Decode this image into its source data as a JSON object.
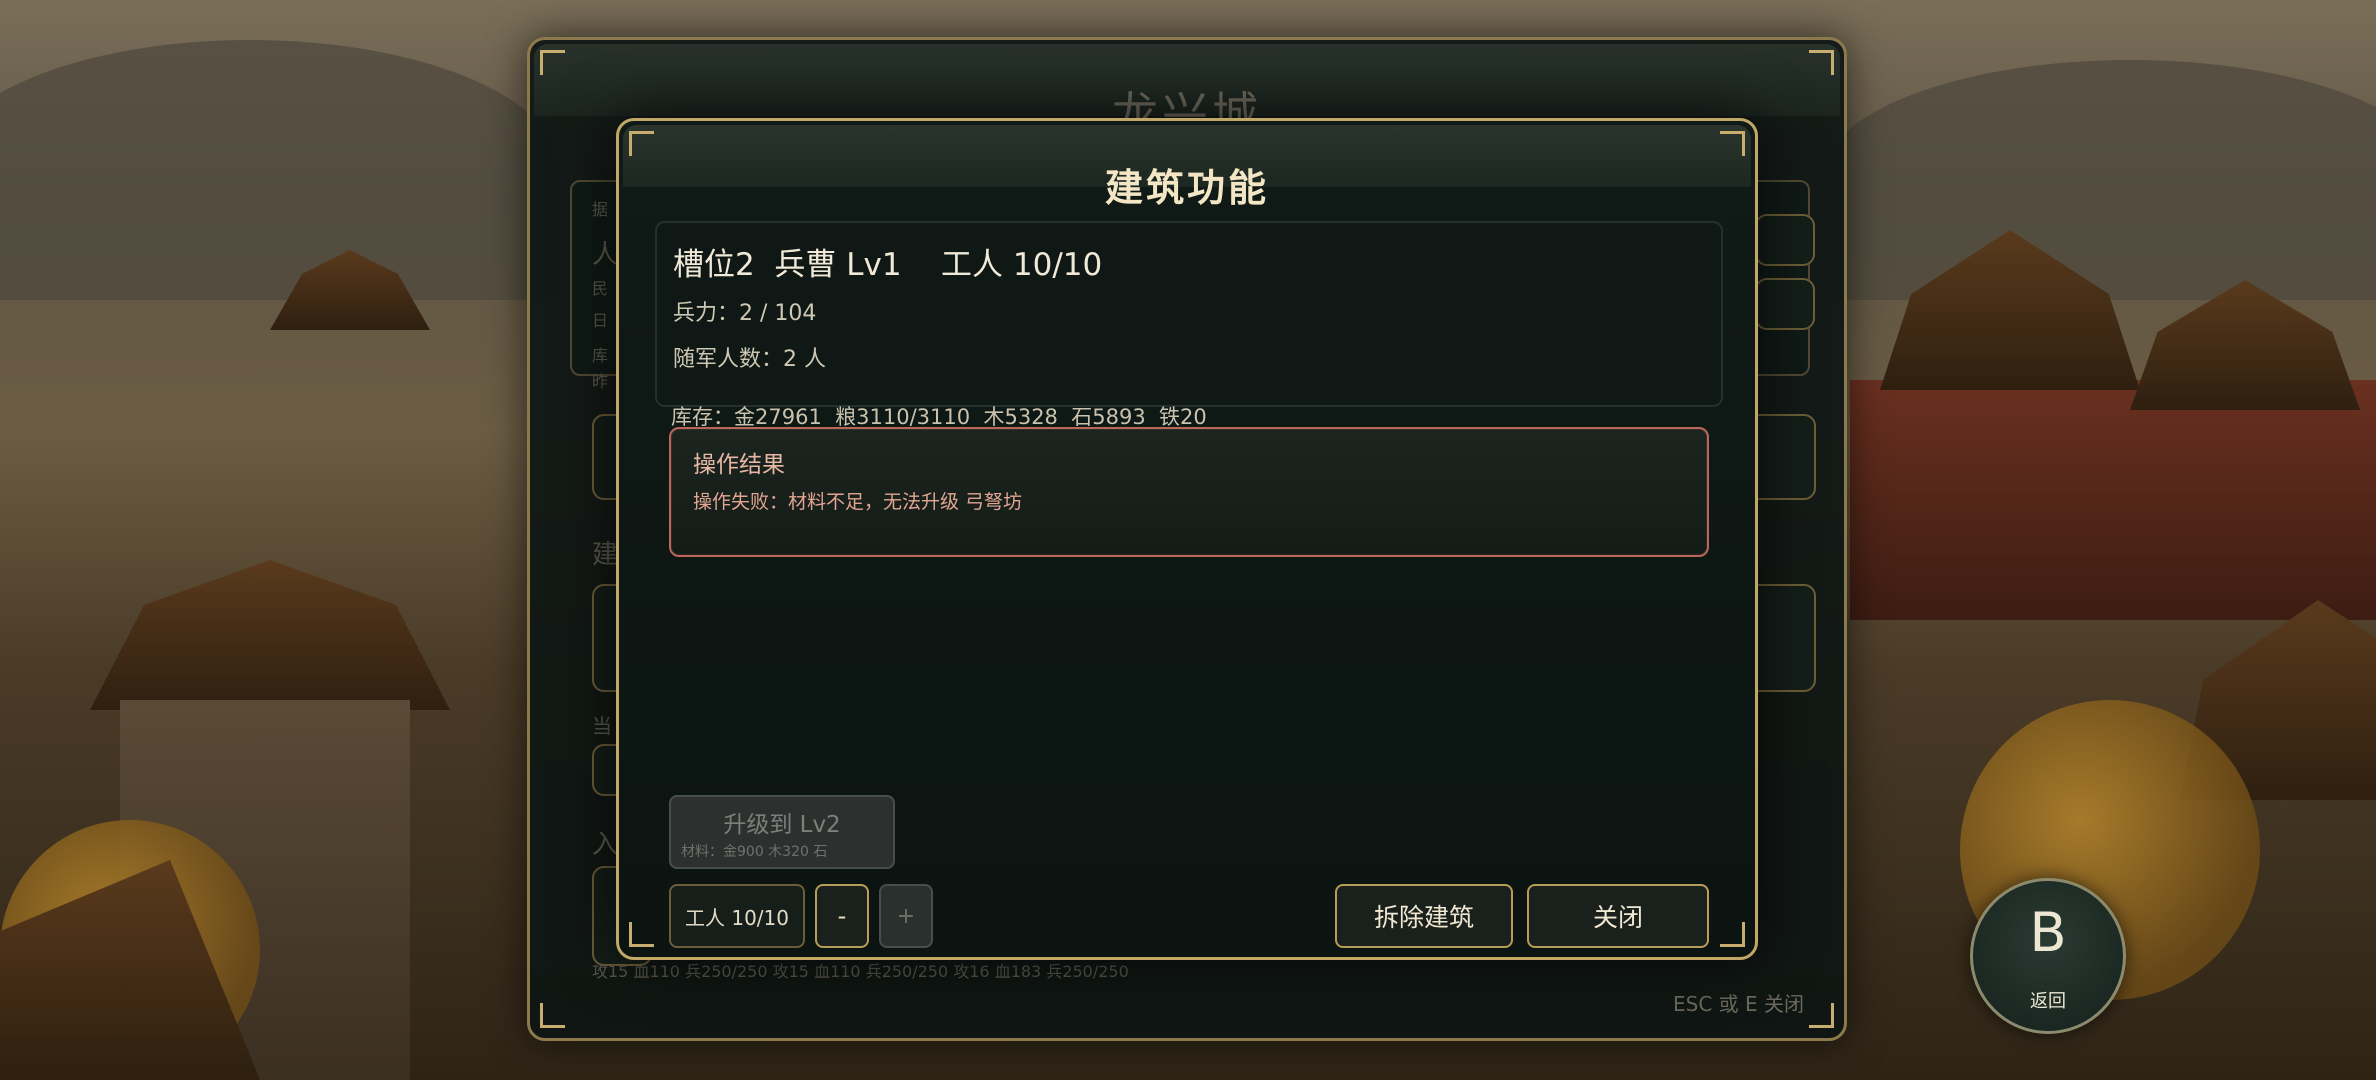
{
  "background_panel": {
    "title": "龙兴城",
    "ghost_labels": [
      "据",
      "人",
      "民",
      "日",
      "库",
      "昨",
      "建",
      "当",
      "入"
    ],
    "footer_stats": "攻15 血110 兵250/250    攻15 血110 兵250/250    攻16 血183 兵250/250",
    "esc_hint": "ESC 或 E 关闭"
  },
  "modal": {
    "title": "建筑功能",
    "info": {
      "header": "槽位2  兵曹 Lv1    工人 10/10",
      "troops": "兵力：2 / 104",
      "followers": "随军人数：2 人"
    },
    "stock": "库存：金27961  粮3110/3110  木5328  石5893  铁20",
    "result": {
      "title": "操作结果",
      "message": "操作失败：材料不足，无法升级 弓弩坊"
    },
    "upgrade": {
      "label": "升级到 Lv2",
      "cost": "材料：金900 木320 石"
    },
    "buttons": {
      "worker": "工人 10/10",
      "minus": "-",
      "plus": "+",
      "demolish": "拆除建筑",
      "close": "关闭"
    }
  },
  "back_button": {
    "letter": "B",
    "label": "返回"
  },
  "colors": {
    "gold_border": "#c2a867",
    "panel_bg": "#0f1815",
    "error_border": "#b8675a",
    "error_text": "#e2a592"
  }
}
